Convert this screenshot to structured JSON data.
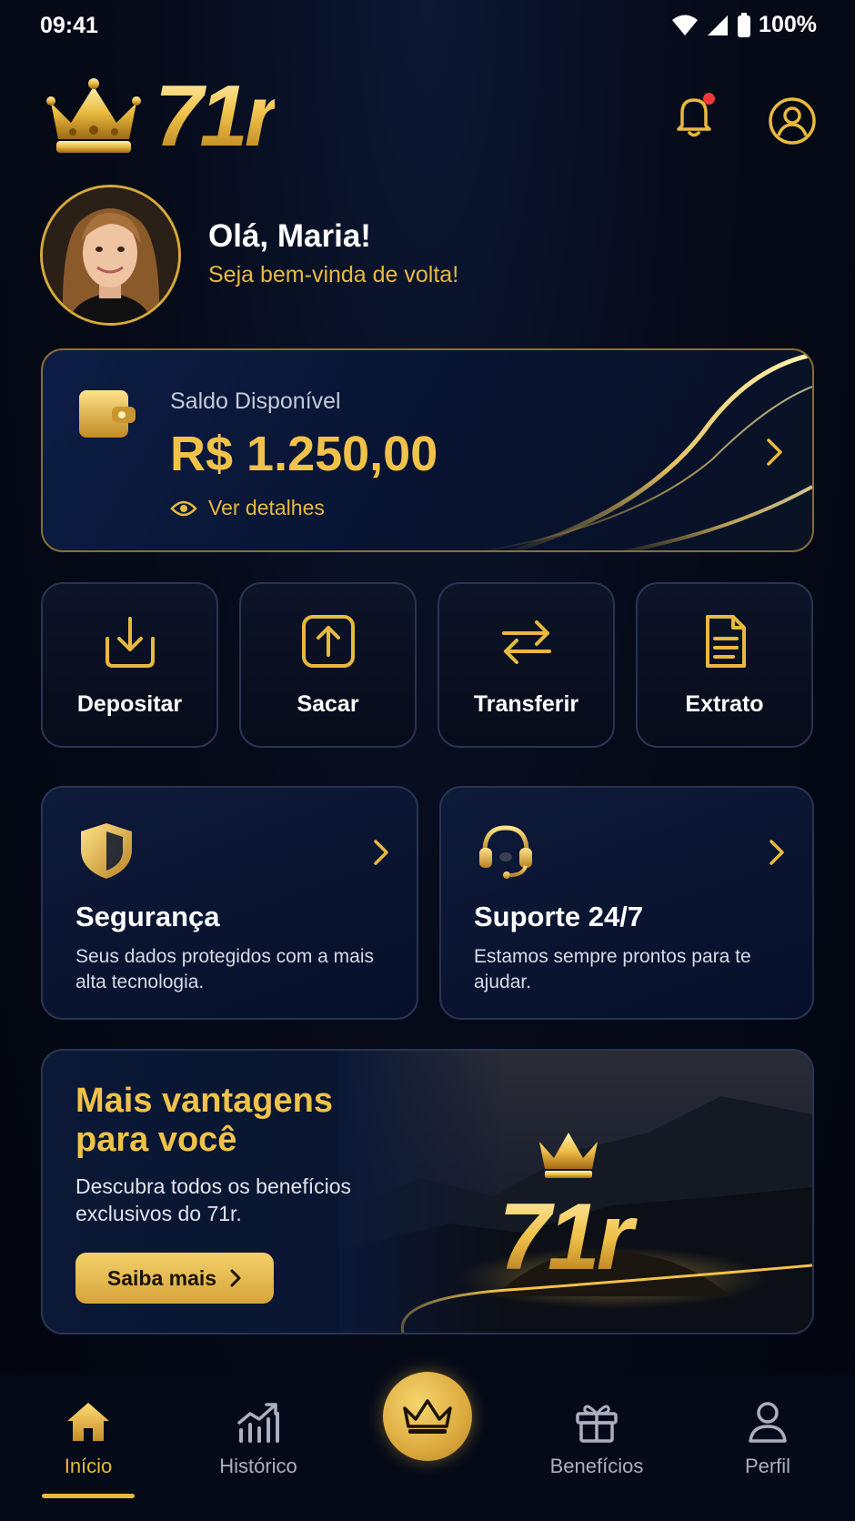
{
  "status_bar": {
    "time": "09:41",
    "battery": "100%"
  },
  "header": {
    "logo_text": "71r"
  },
  "greeting": {
    "title": "Olá, Maria!",
    "subtitle": "Seja bem-vinda de volta!"
  },
  "balance": {
    "label": "Saldo Disponível",
    "value": "R$ 1.250,00",
    "details_link": "Ver detalhes"
  },
  "actions": [
    {
      "label": "Depositar",
      "icon": "download-icon"
    },
    {
      "label": "Sacar",
      "icon": "upload-icon"
    },
    {
      "label": "Transferir",
      "icon": "transfer-icon"
    },
    {
      "label": "Extrato",
      "icon": "document-icon"
    }
  ],
  "info_cards": [
    {
      "title": "Segurança",
      "description": "Seus dados protegidos com a mais alta tecnologia.",
      "icon": "shield-icon"
    },
    {
      "title": "Suporte 24/7",
      "description": "Estamos sempre prontos para te ajudar.",
      "icon": "headset-icon"
    }
  ],
  "promo": {
    "title": "Mais vantagens para você",
    "description": "Descubra todos os benefícios exclusivos do 71r.",
    "button_label": "Saiba mais",
    "logo_text": "71r"
  },
  "bottom_nav": [
    {
      "label": "Início",
      "icon": "home-icon",
      "active": true
    },
    {
      "label": "Histórico",
      "icon": "chart-icon",
      "active": false
    },
    {
      "label": "",
      "icon": "crown-icon",
      "active": false
    },
    {
      "label": "Benefícios",
      "icon": "gift-icon",
      "active": false
    },
    {
      "label": "Perfil",
      "icon": "user-icon",
      "active": false
    }
  ],
  "colors": {
    "accent_gold": "#e8b93f",
    "background": "#060b1a",
    "notification_dot": "#f0383a"
  }
}
